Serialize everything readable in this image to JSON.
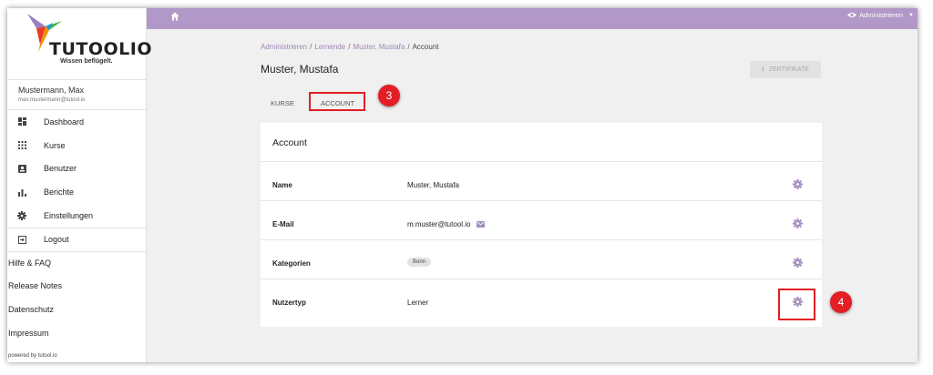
{
  "sidebar": {
    "logo_text": "TUTOOLIO",
    "logo_tagline": "Wissen beflügelt.",
    "user_name": "Mustermann, Max",
    "user_email": "max.mustermann@tutool.io",
    "nav": [
      {
        "label": "Dashboard",
        "icon": "dashboard-icon"
      },
      {
        "label": "Kurse",
        "icon": "grid-icon"
      },
      {
        "label": "Benutzer",
        "icon": "user-card-icon"
      },
      {
        "label": "Berichte",
        "icon": "bar-chart-icon"
      },
      {
        "label": "Einstellungen",
        "icon": "gear-icon"
      },
      {
        "label": "Logout",
        "icon": "logout-icon"
      }
    ],
    "links": [
      "Hilfe & FAQ",
      "Release Notes",
      "Datenschutz",
      "Impressum"
    ],
    "powered_by": "powered by tutool.io"
  },
  "topbar": {
    "color": "#b198c8",
    "home_icon": "home-icon",
    "admin_label": "Administrieren"
  },
  "breadcrumb": {
    "items": [
      "Administrieren",
      "Lernende",
      "Muster, Mustafa"
    ],
    "current": "Account"
  },
  "page_title": "Muster, Mustafa",
  "certificates_button": "ZERTIFIKATE",
  "tabs": [
    "KURSE",
    "ACCOUNT"
  ],
  "card": {
    "title": "Account",
    "rows": [
      {
        "label": "Name",
        "value": "Muster, Mustafa"
      },
      {
        "label": "E-Mail",
        "value": "m.muster@tutool.io"
      },
      {
        "label": "Kategorien",
        "value": "Bonn"
      },
      {
        "label": "Nutzertyp",
        "value": "Lerner"
      }
    ]
  },
  "callouts": [
    "3",
    "4"
  ],
  "colors": {
    "accent": "#b198c8",
    "link": "#9d86b5",
    "highlight": "#e31e24",
    "icon": "#a58fc0"
  }
}
